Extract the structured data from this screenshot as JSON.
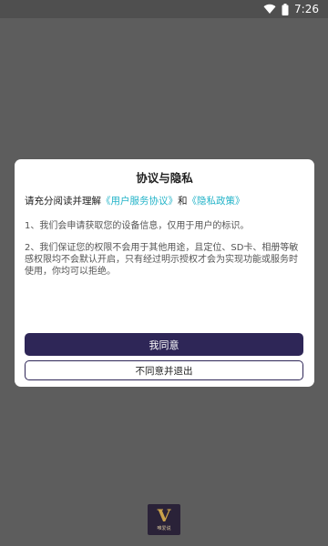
{
  "status_bar": {
    "time": "7:26",
    "wifi_icon": "wifi-icon",
    "battery_icon": "battery-icon"
  },
  "dialog": {
    "title": "协议与隐私",
    "intro_prefix": "请充分阅读并理解",
    "link_user_agreement": "《用户服务协议》",
    "intro_and": "和",
    "link_privacy_policy": "《隐私政策》",
    "paragraph_1": "1、我们会申请获取您的设备信息，仅用于用户的标识。",
    "paragraph_2": "2、我们保证您的权限不会用于其他用途，且定位、SD卡、相册等敏感权限均不会默认开启，只有经过明示授权才会为实现功能或服务时使用，你均可以拒绝。",
    "agree_label": "我同意",
    "disagree_label": "不同意并退出"
  },
  "app_logo": {
    "letter": "V",
    "caption": "唯爱说"
  },
  "colors": {
    "background": "#5d5d5d",
    "status_bar": "#4f4f4f",
    "primary_button": "#2e2657",
    "link": "#22b3c8",
    "logo_bg": "#2a2238",
    "logo_gold": "#c9a14a"
  }
}
